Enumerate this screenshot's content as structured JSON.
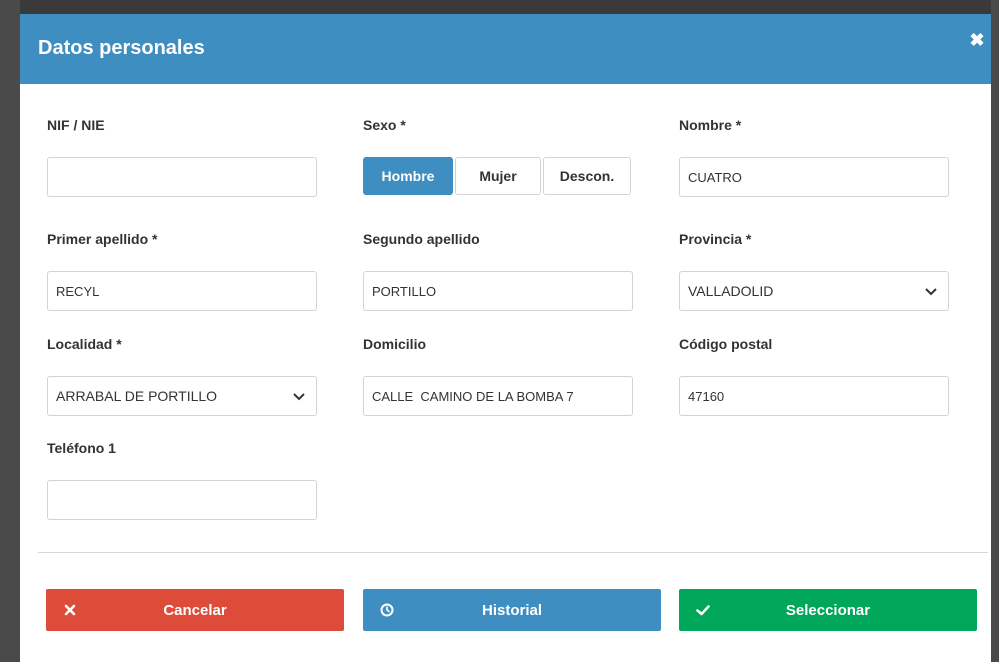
{
  "dialog": {
    "title": "Datos personales",
    "close_icon": "close-icon"
  },
  "fields": {
    "nif": {
      "label": "NIF / NIE",
      "value": ""
    },
    "sexo": {
      "label": "Sexo *",
      "options": [
        "Hombre",
        "Mujer",
        "Descon."
      ],
      "selected": "Hombre"
    },
    "nombre": {
      "label": "Nombre *",
      "value": "CUATRO"
    },
    "primer_apellido": {
      "label": "Primer apellido *",
      "value": "RECYL"
    },
    "segundo_apellido": {
      "label": "Segundo apellido",
      "value": "PORTILLO"
    },
    "provincia": {
      "label": "Provincia *",
      "value": "VALLADOLID"
    },
    "localidad": {
      "label": "Localidad *",
      "value": "ARRABAL DE PORTILLO"
    },
    "domicilio": {
      "label": "Domicilio",
      "value": "CALLE  CAMINO DE LA BOMBA 7"
    },
    "codigo_postal": {
      "label": "Código postal",
      "value": "47160"
    },
    "telefono1": {
      "label": "Teléfono 1",
      "value": ""
    }
  },
  "actions": {
    "cancel": {
      "label": "Cancelar",
      "icon": "close-icon",
      "color": "#dd4b39"
    },
    "history": {
      "label": "Historial",
      "icon": "clock-icon",
      "color": "#3f8ec1"
    },
    "select": {
      "label": "Seleccionar",
      "icon": "check-icon",
      "color": "#00a65a"
    }
  },
  "colors": {
    "header": "#3f8ec1",
    "active_toggle": "#3f8ec1"
  }
}
